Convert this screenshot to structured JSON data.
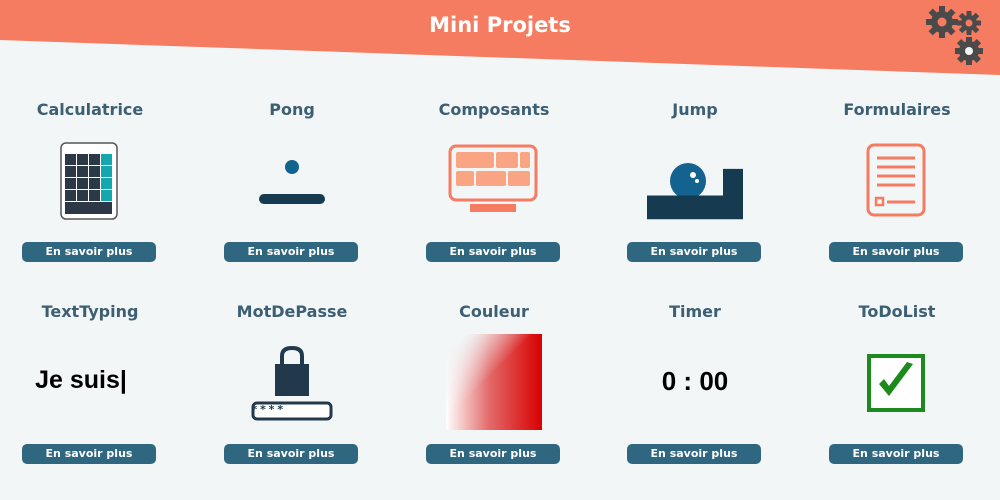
{
  "header": {
    "title": "Mini Projets",
    "settings_icon": "gears-icon"
  },
  "colors": {
    "banner": "#f57c61",
    "button": "#2f6680",
    "card_title": "#3d5f73",
    "background": "#f2f6f7"
  },
  "projects": [
    {
      "title": "Calculatrice",
      "icon": "calculator-icon",
      "button_label": "En savoir plus"
    },
    {
      "title": "Pong",
      "icon": "pong-icon",
      "button_label": "En savoir plus"
    },
    {
      "title": "Composants",
      "icon": "components-icon",
      "button_label": "En savoir plus"
    },
    {
      "title": "Jump",
      "icon": "jump-game-icon",
      "button_label": "En savoir plus"
    },
    {
      "title": "Formulaires",
      "icon": "form-document-icon",
      "button_label": "En savoir plus"
    },
    {
      "title": "TextTyping",
      "icon": "typing-text",
      "preview_text": "Je suis|",
      "button_label": "En savoir plus"
    },
    {
      "title": "MotDePasse",
      "icon": "padlock-password-icon",
      "password_mask": "****",
      "button_label": "En savoir plus"
    },
    {
      "title": "Couleur",
      "icon": "color-gradient-swatch",
      "button_label": "En savoir plus"
    },
    {
      "title": "Timer",
      "icon": "timer-display",
      "time_text": "0 : 00",
      "button_label": "En savoir plus"
    },
    {
      "title": "ToDoList",
      "icon": "checkbox-checked-icon",
      "button_label": "En savoir plus"
    }
  ]
}
